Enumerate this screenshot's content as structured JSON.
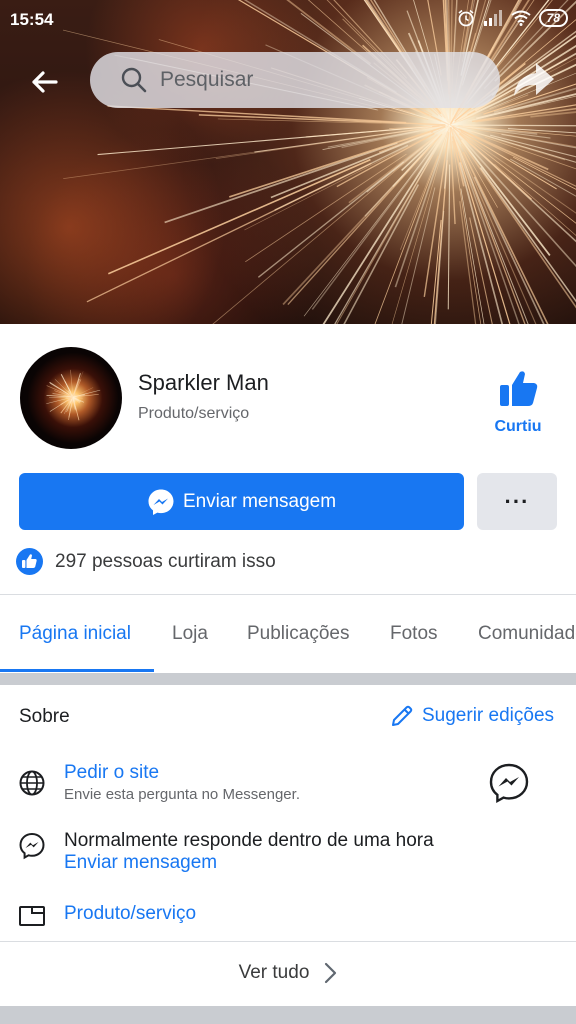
{
  "status_bar": {
    "time": "15:54",
    "battery": "78"
  },
  "search": {
    "placeholder": "Pesquisar"
  },
  "page": {
    "name": "Sparkler Man",
    "category": "Produto/serviço",
    "liked_label": "Curtiu"
  },
  "actions": {
    "send_message": "Enviar mensagem",
    "more": "···"
  },
  "likes": {
    "text": "297 pessoas curtiram isso"
  },
  "tabs": [
    {
      "label": "Página inicial"
    },
    {
      "label": "Loja"
    },
    {
      "label": "Publicações"
    },
    {
      "label": "Fotos"
    },
    {
      "label": "Comunidade"
    }
  ],
  "about": {
    "title": "Sobre",
    "suggest_edits": "Sugerir edições",
    "website": {
      "title": "Pedir o site",
      "subtitle": "Envie esta pergunta no Messenger."
    },
    "response": {
      "text": "Normalmente responde dentro de uma hora",
      "link": "Enviar mensagem"
    },
    "category": {
      "text": "Produto/serviço"
    },
    "see_all": "Ver tudo"
  },
  "colors": {
    "accent": "#1877f2",
    "secondary_button": "#e4e6eb",
    "muted_text": "#65676b"
  }
}
